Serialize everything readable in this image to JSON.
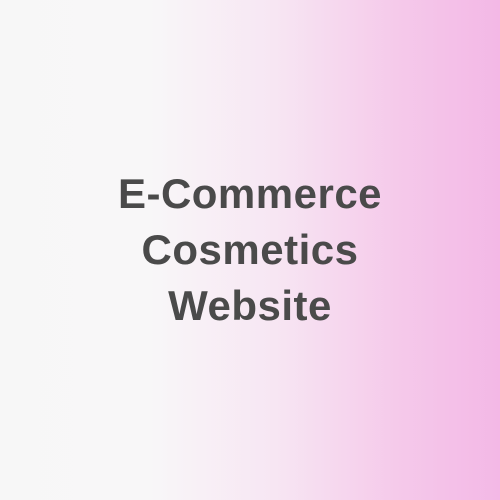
{
  "title": {
    "lines": [
      "E-Commerce",
      "Cosmetics",
      "Website"
    ]
  },
  "colors": {
    "text": "#4a4a4a",
    "gradient_left": "#f7f7f7",
    "gradient_right": "#f3b8e6"
  }
}
